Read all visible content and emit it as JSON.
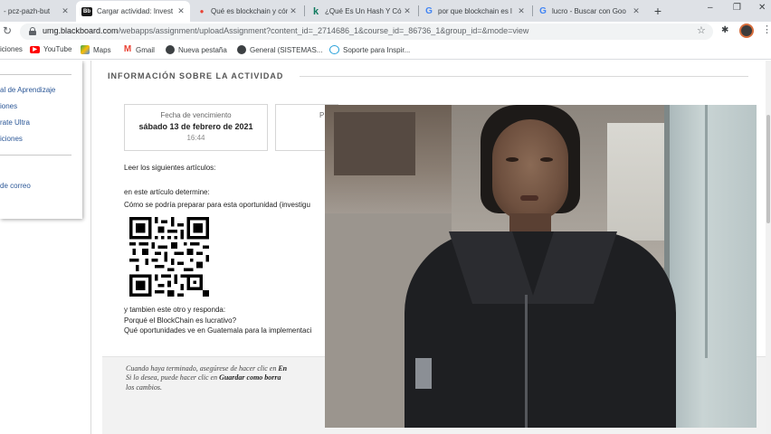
{
  "browser": {
    "tabs": [
      {
        "title": "- pcz-pazh-but",
        "icon": "meet-icon",
        "active": false
      },
      {
        "title": "Cargar actividad: Invest",
        "icon": "blackboard-icon",
        "active": true
      },
      {
        "title": "Qué es blockchain y cóm",
        "icon": "pin-icon",
        "active": false
      },
      {
        "title": "¿Qué Es Un Hash Y Cóm",
        "icon": "k-icon",
        "active": false
      },
      {
        "title": "por que blockchain es l",
        "icon": "google-icon",
        "active": false
      },
      {
        "title": "lucro - Buscar con Goo",
        "icon": "google-icon",
        "active": false
      }
    ],
    "new_tab_symbol": "+",
    "window_controls": {
      "minimize": "–",
      "restore": "❐",
      "close": "✕"
    },
    "url_host": "umg.blackboard.com",
    "url_path": "/webapps/assignment/uploadAssignment?content_id=_2714686_1&course_id=_86736_1&group_id=&mode=view",
    "bookmarks": [
      {
        "label": "iciones",
        "icon": "apps-icon"
      },
      {
        "label": "YouTube",
        "icon": "youtube-icon",
        "color": "#ff0000"
      },
      {
        "label": "Maps",
        "icon": "maps-icon",
        "color": "#34a853"
      },
      {
        "label": "Gmail",
        "icon": "gmail-icon",
        "color": "#ea4335"
      },
      {
        "label": "Nueva pestaña",
        "icon": "globe-icon"
      },
      {
        "label": "General (SISTEMAS...",
        "icon": "globe-icon"
      },
      {
        "label": "Soporte para Inspir...",
        "icon": "support-icon"
      }
    ]
  },
  "sidebar": {
    "items": [
      "al de Aprendizaje",
      "iones",
      "rate Ultra",
      "iciones",
      "",
      "de correo"
    ]
  },
  "main": {
    "section_title": "INFORMACIÓN SOBRE LA ACTIVIDAD",
    "due": {
      "label": "Fecha de vencimiento",
      "date": "sábado 13 de febrero de 2021",
      "time": "16:44"
    },
    "second_card_label": "P",
    "read_line": "Leer los siguientes artículos:",
    "determine_line": "en este artículo determine:",
    "question_line": "Cómo se podría preparar para esta oportunidad (investigu",
    "also_line": "y tambien este otro y responda:",
    "q1": "Porqué el BlockChain es lucrativo?",
    "q2": "Qué oportunidades ve en Guatemala para la implementaci",
    "instructions": {
      "line1_prefix": "Cuando haya terminado, asegúrese de hacer clic en ",
      "line1_bold": "En",
      "line2_prefix": "Si lo desea, puede hacer clic en ",
      "line2_bold": "Guardar como borra",
      "line3": "los cambios."
    }
  },
  "colors": {
    "tabbar": "#dee1e6",
    "link": "#2b5797",
    "instructions_bg": "#f2f2f2"
  }
}
